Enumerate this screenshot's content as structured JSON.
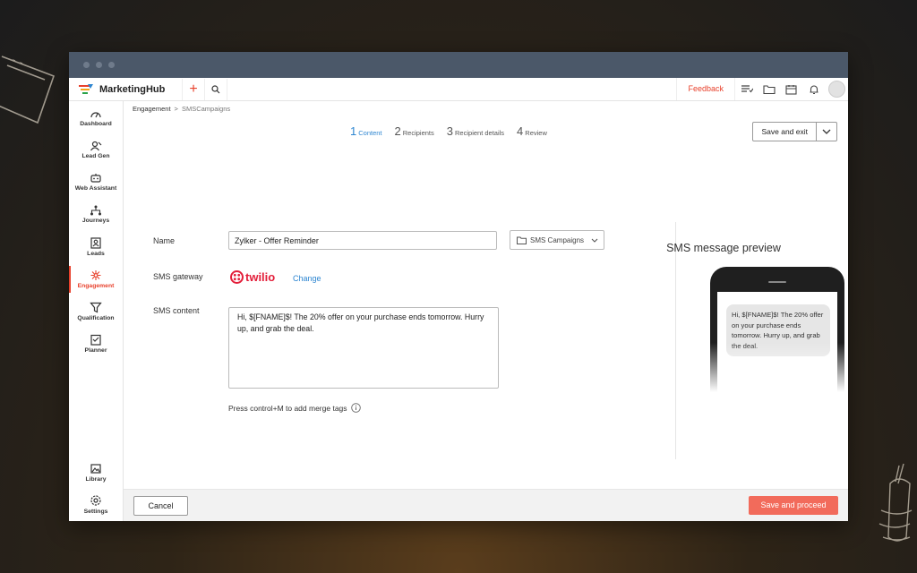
{
  "app": {
    "name": "MarketingHub"
  },
  "topbar": {
    "feedback_label": "Feedback",
    "add_icon": "+"
  },
  "sidebar": {
    "items": [
      {
        "label": "Dashboard",
        "icon": "dashboard-icon"
      },
      {
        "label": "Lead Gen",
        "icon": "lead-gen-icon"
      },
      {
        "label": "Web Assistant",
        "icon": "web-assistant-icon"
      },
      {
        "label": "Journeys",
        "icon": "journeys-icon"
      },
      {
        "label": "Leads",
        "icon": "leads-icon"
      },
      {
        "label": "Engagement",
        "icon": "engagement-icon",
        "active": true
      },
      {
        "label": "Qualification",
        "icon": "qualification-icon"
      },
      {
        "label": "Planner",
        "icon": "planner-icon"
      }
    ],
    "bottom_items": [
      {
        "label": "Library",
        "icon": "library-icon"
      },
      {
        "label": "Settings",
        "icon": "settings-icon"
      }
    ]
  },
  "breadcrumb": {
    "parent": "Engagement",
    "separator": ">",
    "current": "SMSCampaigns"
  },
  "steps": [
    {
      "num": "1",
      "label": "Content",
      "active": true
    },
    {
      "num": "2",
      "label": "Recipients"
    },
    {
      "num": "3",
      "label": "Recipient details"
    },
    {
      "num": "4",
      "label": "Review"
    }
  ],
  "save_exit": {
    "label": "Save and exit"
  },
  "form": {
    "name_label": "Name",
    "name_value": "Zylker - Offer Reminder",
    "folder_value": "SMS Campaigns",
    "gateway_label": "SMS gateway",
    "gateway_name": "twilio",
    "change_label": "Change",
    "content_label": "SMS content",
    "content_value": "Hi, $[FNAME]$! The 20% offer on your purchase ends tomorrow. Hurry up, and grab the deal.",
    "hint": "Press control+M to add merge tags"
  },
  "preview": {
    "title": "SMS message preview",
    "message": "Hi, $[FNAME]$! The 20% offer on your purchase ends tomorrow. Hurry up, and grab the deal."
  },
  "footer": {
    "cancel_label": "Cancel",
    "proceed_label": "Save and proceed"
  },
  "colors": {
    "accent": "#e8412c",
    "link": "#2e86d1",
    "primary_button": "#f26b5b",
    "titlebar": "#4b5869"
  }
}
